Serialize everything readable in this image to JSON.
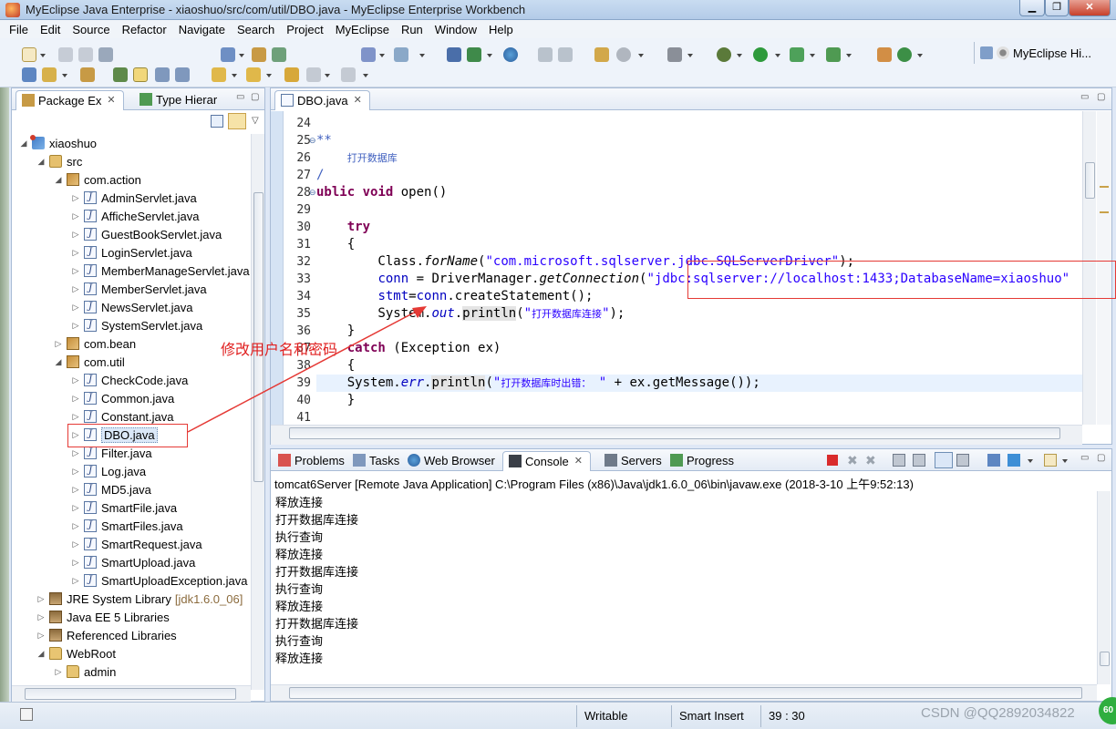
{
  "window": {
    "title": "MyEclipse Java Enterprise - xiaoshuo/src/com/util/DBO.java - MyEclipse Enterprise Workbench"
  },
  "menu": [
    "File",
    "Edit",
    "Source",
    "Refactor",
    "Navigate",
    "Search",
    "Project",
    "MyEclipse",
    "Run",
    "Window",
    "Help"
  ],
  "perspective": {
    "label": "MyEclipse Hi..."
  },
  "explorer": {
    "tabs": [
      {
        "label": "Package Ex"
      },
      {
        "label": "Type Hierar"
      }
    ],
    "tree": [
      {
        "label": "xiaoshuo",
        "level": 0,
        "icon": "project-icon",
        "state": "expanded"
      },
      {
        "label": "src",
        "level": 1,
        "icon": "source-folder-icon",
        "state": "expanded"
      },
      {
        "label": "com.action",
        "level": 2,
        "icon": "package-icon",
        "state": "expanded"
      },
      {
        "label": "AdminServlet.java",
        "level": 3,
        "icon": "java-file-icon",
        "state": "collapsed"
      },
      {
        "label": "AfficheServlet.java",
        "level": 3,
        "icon": "java-file-icon",
        "state": "collapsed"
      },
      {
        "label": "GuestBookServlet.java",
        "level": 3,
        "icon": "java-file-icon",
        "state": "collapsed"
      },
      {
        "label": "LoginServlet.java",
        "level": 3,
        "icon": "java-file-icon",
        "state": "collapsed"
      },
      {
        "label": "MemberManageServlet.java",
        "level": 3,
        "icon": "java-file-icon",
        "state": "collapsed"
      },
      {
        "label": "MemberServlet.java",
        "level": 3,
        "icon": "java-file-icon",
        "state": "collapsed"
      },
      {
        "label": "NewsServlet.java",
        "level": 3,
        "icon": "java-file-icon",
        "state": "collapsed"
      },
      {
        "label": "SystemServlet.java",
        "level": 3,
        "icon": "java-file-icon",
        "state": "collapsed"
      },
      {
        "label": "com.bean",
        "level": 2,
        "icon": "package-icon",
        "state": "collapsed"
      },
      {
        "label": "com.util",
        "level": 2,
        "icon": "package-icon",
        "state": "expanded"
      },
      {
        "label": "CheckCode.java",
        "level": 3,
        "icon": "java-file-icon",
        "state": "collapsed"
      },
      {
        "label": "Common.java",
        "level": 3,
        "icon": "java-file-icon",
        "state": "collapsed"
      },
      {
        "label": "Constant.java",
        "level": 3,
        "icon": "java-file-icon",
        "state": "collapsed"
      },
      {
        "label": "DBO.java",
        "level": 3,
        "icon": "java-file-icon",
        "state": "collapsed",
        "selected": true
      },
      {
        "label": "Filter.java",
        "level": 3,
        "icon": "java-file-icon",
        "state": "collapsed"
      },
      {
        "label": "Log.java",
        "level": 3,
        "icon": "java-file-icon",
        "state": "collapsed"
      },
      {
        "label": "MD5.java",
        "level": 3,
        "icon": "java-file-icon",
        "state": "collapsed"
      },
      {
        "label": "SmartFile.java",
        "level": 3,
        "icon": "java-file-icon",
        "state": "collapsed"
      },
      {
        "label": "SmartFiles.java",
        "level": 3,
        "icon": "java-file-icon",
        "state": "collapsed"
      },
      {
        "label": "SmartRequest.java",
        "level": 3,
        "icon": "java-file-icon",
        "state": "collapsed"
      },
      {
        "label": "SmartUpload.java",
        "level": 3,
        "icon": "java-file-icon",
        "state": "collapsed"
      },
      {
        "label": "SmartUploadException.java",
        "level": 3,
        "icon": "java-file-icon",
        "state": "collapsed"
      },
      {
        "label": "JRE System Library",
        "decoration": "[jdk1.6.0_06]",
        "level": 1,
        "icon": "library-icon",
        "state": "collapsed"
      },
      {
        "label": "Java EE 5 Libraries",
        "level": 1,
        "icon": "library-icon",
        "state": "collapsed"
      },
      {
        "label": "Referenced Libraries",
        "level": 1,
        "icon": "library-icon",
        "state": "collapsed"
      },
      {
        "label": "WebRoot",
        "level": 1,
        "icon": "folder-icon",
        "state": "expanded"
      },
      {
        "label": "admin",
        "level": 2,
        "icon": "folder-icon",
        "state": "collapsed"
      }
    ]
  },
  "editor": {
    "tab": "DBO.java",
    "lines": [
      {
        "n": "24",
        "html": ""
      },
      {
        "n": "25",
        "html": "<span class='cmt'>**</span>",
        "fold": true
      },
      {
        "n": "26",
        "html": "<span class='cmt'>    <span class='cn'>打开数据库</span></span>"
      },
      {
        "n": "27",
        "html": "<span class='cmt'>/</span>"
      },
      {
        "n": "28",
        "html": "<span class='kw'>ublic</span> <span class='kw'>void</span> open()",
        "fold": true
      },
      {
        "n": "29",
        "html": ""
      },
      {
        "n": "30",
        "html": "    <span class='kw'>try</span>"
      },
      {
        "n": "31",
        "html": "    {"
      },
      {
        "n": "32",
        "html": "        Class.<span class='ital'>forName</span>(<span class='str'>\"com.microsoft.sqlserver.jdbc.SQLServerDriver\"</span>);"
      },
      {
        "n": "33",
        "html": "        <span class='fld'>conn</span> = DriverManager.<span class='ital'>getConnection</span>(<span class='str'>\"jdbc:sqlserver://localhost:1433;DatabaseName=xiaoshuo\"</span>"
      },
      {
        "n": "34",
        "html": "        <span class='fld'>stmt</span>=<span class='fld'>conn</span>.createStatement();"
      },
      {
        "n": "35",
        "html": "        System.<span class='fld ital'>out</span>.<span class='box-occ'>println</span>(<span class='str'>\"<span class='cn'>打开数据库连接</span>\"</span>);"
      },
      {
        "n": "36",
        "html": "    }"
      },
      {
        "n": "37",
        "html": "    <span class='kw'>catch</span> (Exception ex)"
      },
      {
        "n": "38",
        "html": "    {"
      },
      {
        "n": "39",
        "html": "    System.<span class='fld ital'>err</span>.<span class='box-occ'>println</span>(<span class='str'>\"<span class='cn'>打开数据库时出错：</span> \"</span> + ex.getMessage());",
        "current": true
      },
      {
        "n": "40",
        "html": "    }"
      },
      {
        "n": "41",
        "html": ""
      }
    ]
  },
  "console": {
    "tabs": [
      {
        "label": "Problems"
      },
      {
        "label": "Tasks"
      },
      {
        "label": "Web Browser"
      },
      {
        "label": "Console"
      },
      {
        "label": "Servers"
      },
      {
        "label": "Progress"
      }
    ],
    "header": "tomcat6Server [Remote Java Application] C:\\Program Files (x86)\\Java\\jdk1.6.0_06\\bin\\javaw.exe (2018-3-10 上午9:52:13)",
    "lines": [
      "释放连接",
      "打开数据库连接",
      "执行查询",
      "释放连接",
      "打开数据库连接",
      "执行查询",
      "释放连接",
      "打开数据库连接",
      "执行查询",
      "释放连接"
    ]
  },
  "status": {
    "mode": "Writable",
    "insert": "Smart Insert",
    "position": "39 : 30",
    "watermark": "CSDN @QQ2892034822",
    "badge": "60"
  },
  "annotation": {
    "text": "修改用户名和密码",
    "color": "#e02020"
  }
}
